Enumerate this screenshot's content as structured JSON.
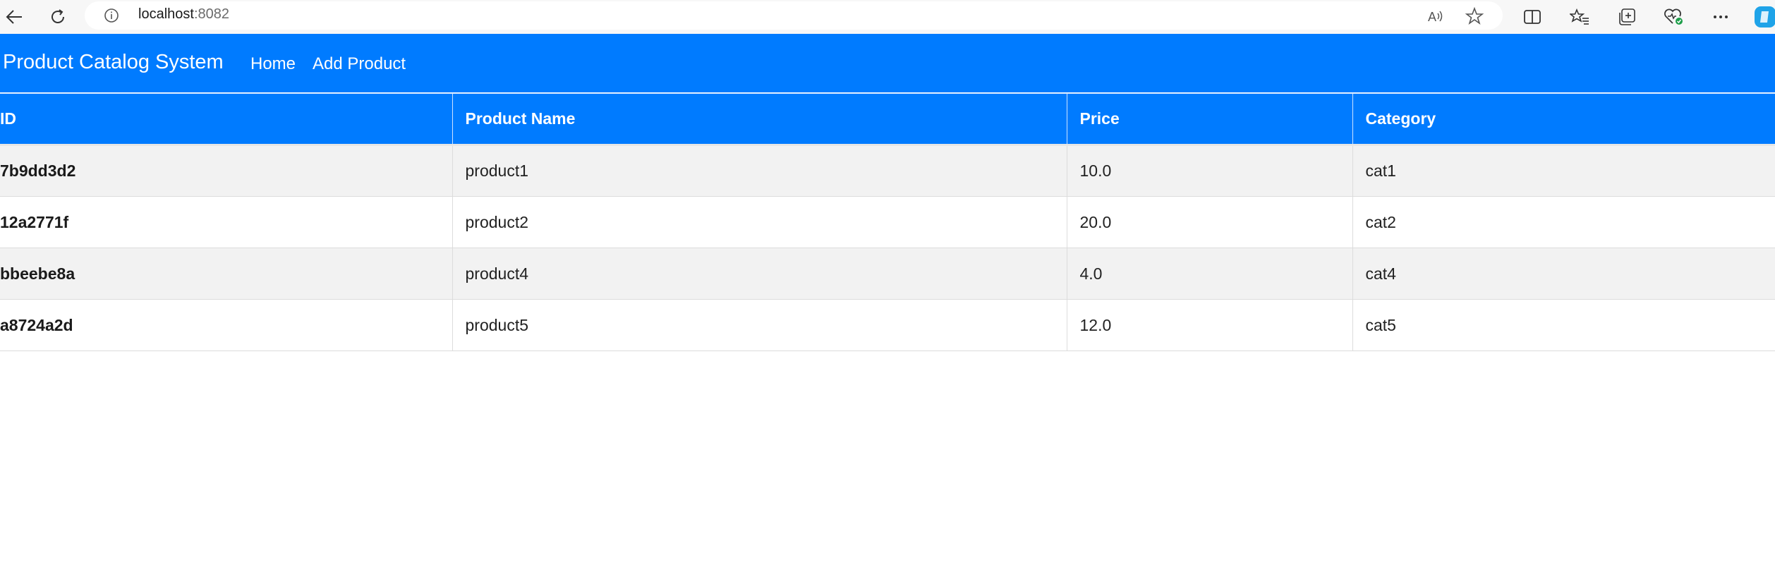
{
  "browser": {
    "url_host": "localhost",
    "url_port": ":8082"
  },
  "navbar": {
    "brand": "Product Catalog System",
    "links": [
      "Home",
      "Add Product"
    ]
  },
  "table": {
    "headers": [
      "ID",
      "Product Name",
      "Price",
      "Category"
    ],
    "rows": [
      [
        "7b9dd3d2",
        "product1",
        "10.0",
        "cat1"
      ],
      [
        "12a2771f",
        "product2",
        "20.0",
        "cat2"
      ],
      [
        "bbeebe8a",
        "product4",
        "4.0",
        "cat4"
      ],
      [
        "a8724a2d",
        "product5",
        "12.0",
        "cat5"
      ]
    ]
  },
  "colors": {
    "primary": "#007bff",
    "row_alt": "#f2f2f2"
  }
}
